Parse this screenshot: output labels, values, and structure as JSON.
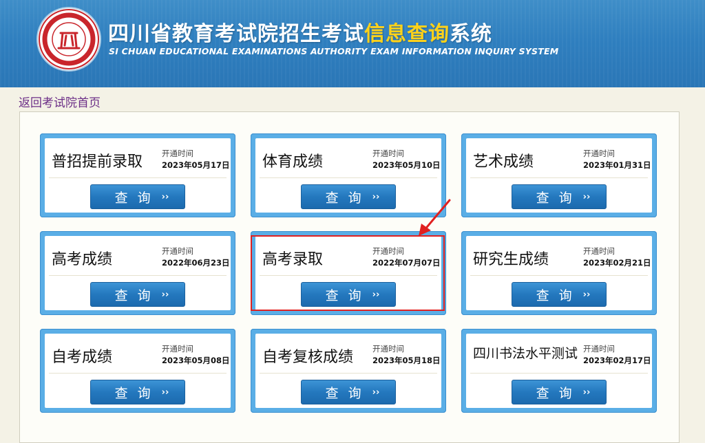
{
  "header": {
    "title_main": "四川省教育考试院招生考试",
    "title_highlight": "信息查询",
    "title_suffix": "系统",
    "subtitle": "SI CHUAN EDUCATIONAL EXAMINATIONS AUTHORITY EXAM INFORMATION INQUIRY SYSTEM",
    "logo_text": "SICHUAN EDUCATIONAL EXAMINATIONS AUTHORITY 四川省教育考试院"
  },
  "nav": {
    "back_link": "返回考试院首页"
  },
  "cards": [
    {
      "name": "普招提前录取",
      "open_label": "开通时间",
      "date": "2023年05月17日",
      "button": "查询"
    },
    {
      "name": "体育成绩",
      "open_label": "开通时间",
      "date": "2023年05月10日",
      "button": "查询"
    },
    {
      "name": "艺术成绩",
      "open_label": "开通时间",
      "date": "2023年01月31日",
      "button": "查询"
    },
    {
      "name": "高考成绩",
      "open_label": "开通时间",
      "date": "2022年06月23日",
      "button": "查询"
    },
    {
      "name": "高考录取",
      "open_label": "开通时间",
      "date": "2022年07月07日",
      "button": "查询"
    },
    {
      "name": "研究生成绩",
      "open_label": "开通时间",
      "date": "2023年02月21日",
      "button": "查询"
    },
    {
      "name": "自考成绩",
      "open_label": "开通时间",
      "date": "2023年05月08日",
      "button": "查询"
    },
    {
      "name": "自考复核成绩",
      "open_label": "开通时间",
      "date": "2023年05月18日",
      "button": "查询"
    },
    {
      "name": "四川书法水平测试",
      "open_label": "开通时间",
      "date": "2023年02月17日",
      "button": "查询"
    }
  ],
  "icons": {
    "button_arrow": "double-chevron-right-icon",
    "logo": "sichuan-eea-seal-logo"
  },
  "colors": {
    "header_blue": "#2f7fbf",
    "title_highlight": "#ffd21a",
    "card_border": "#5aaee6",
    "button_blue": "#2478be",
    "annotation_red": "#e02020"
  }
}
